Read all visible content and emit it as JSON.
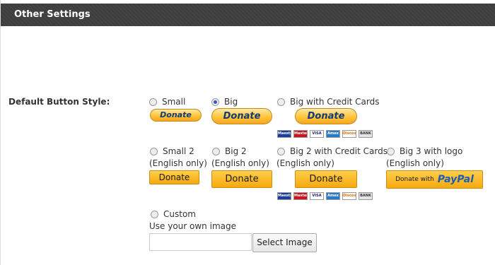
{
  "header": {
    "title": "Other Settings"
  },
  "setting": {
    "label": "Default Button Style:"
  },
  "options": {
    "small": {
      "label": "Small",
      "button": "Donate"
    },
    "big": {
      "label": "Big",
      "button": "Donate",
      "selected": true
    },
    "big_cc": {
      "label": "Big with Credit Cards",
      "button": "Donate"
    },
    "small2": {
      "label": "Small 2",
      "note": "(English only)",
      "button": "Donate"
    },
    "big2": {
      "label": "Big 2",
      "note": "(English only)",
      "button": "Donate"
    },
    "big2_cc": {
      "label": "Big 2 with Credit Cards",
      "note": "(English only)",
      "button": "Donate"
    },
    "big3_logo": {
      "label": "Big 3 with logo",
      "note": "(English only)",
      "button_prefix": "Donate with",
      "button_brand": "PayPal"
    },
    "custom": {
      "label": "Custom",
      "note": "Use your own image",
      "select_label": "Select Image"
    }
  },
  "cards": [
    "Maestro",
    "MasterCard",
    "VISA",
    "Amex",
    "Discover",
    "BANK"
  ],
  "colors": {
    "header_bg": "#3d3d3d",
    "donate_gold": "#ffc439",
    "paypal_blue": "#123a7a",
    "radio_selected": "#2a58c8"
  }
}
